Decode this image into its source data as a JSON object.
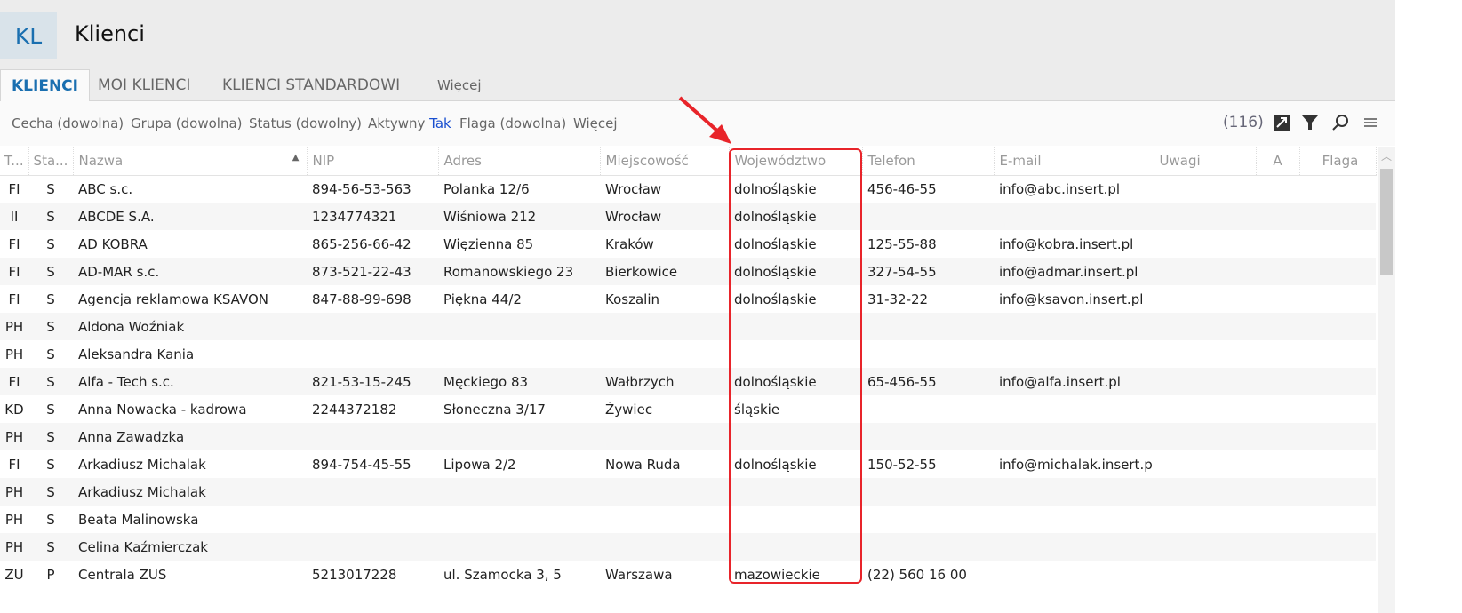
{
  "header": {
    "logo": "KL",
    "title": "Klienci"
  },
  "tabs": [
    "KLIENCI",
    "MOI KLIENCI",
    "KLIENCI STANDARDOWI",
    "Więcej"
  ],
  "filters": {
    "cecha": "Cecha (dowolna)",
    "grupa": "Grupa (dowolna)",
    "status": "Status (dowolny)",
    "aktywny_label": "Aktywny",
    "aktywny_value": "Tak",
    "flaga": "Flaga (dowolna)",
    "wiecej": "Więcej"
  },
  "toolbar": {
    "count": "(116)"
  },
  "columns": [
    "T...",
    "Sta...",
    "Nazwa",
    "NIP",
    "Adres",
    "Miejscowość",
    "Województwo",
    "Telefon",
    "E-mail",
    "Uwagi",
    "A",
    "Flaga"
  ],
  "rows": [
    [
      "FI",
      "S",
      "ABC s.c.",
      "894-56-53-563",
      "Polanka  12/6",
      "Wrocław",
      "dolnośląskie",
      "456-46-55",
      "info@abc.insert.pl"
    ],
    [
      "II",
      "S",
      "ABCDE S.A.",
      "1234774321",
      "Wiśniowa 212",
      "Wrocław",
      "dolnośląskie",
      "",
      ""
    ],
    [
      "FI",
      "S",
      "AD KOBRA",
      "865-256-66-42",
      "Więzienna  85",
      "Kraków",
      "dolnośląskie",
      "125-55-88",
      "info@kobra.insert.pl"
    ],
    [
      "FI",
      "S",
      "AD-MAR s.c.",
      "873-521-22-43",
      "Romanowskiego 23",
      "Bierkowice",
      "dolnośląskie",
      "327-54-55",
      "info@admar.insert.pl"
    ],
    [
      "FI",
      "S",
      "Agencja reklamowa KSAVON",
      "847-88-99-698",
      "Piękna  44/2",
      "Koszalin",
      "dolnośląskie",
      "31-32-22",
      "info@ksavon.insert.pl"
    ],
    [
      "PH",
      "S",
      "Aldona Woźniak",
      "",
      "",
      "",
      "",
      "",
      ""
    ],
    [
      "PH",
      "S",
      "Aleksandra Kania",
      "",
      "",
      "",
      "",
      "",
      ""
    ],
    [
      "FI",
      "S",
      "Alfa - Tech s.c.",
      "821-53-15-245",
      "Męckiego  83",
      "Wałbrzych",
      "dolnośląskie",
      "65-456-55",
      "info@alfa.insert.pl"
    ],
    [
      "KD",
      "S",
      "Anna Nowacka - kadrowa",
      "2244372182",
      "Słoneczna 3/17",
      "Żywiec",
      "śląskie",
      "",
      ""
    ],
    [
      "PH",
      "S",
      "Anna Zawadzka",
      "",
      "",
      "",
      "",
      "",
      ""
    ],
    [
      "FI",
      "S",
      "Arkadiusz Michalak",
      "894-754-45-55",
      "Lipowa  2/2",
      "Nowa Ruda",
      "dolnośląskie",
      "150-52-55",
      "info@michalak.insert.pl"
    ],
    [
      "PH",
      "S",
      "Arkadiusz Michalak",
      "",
      "",
      "",
      "",
      "",
      ""
    ],
    [
      "PH",
      "S",
      "Beata Malinowska",
      "",
      "",
      "",
      "",
      "",
      ""
    ],
    [
      "PH",
      "S",
      "Celina Kaźmierczak",
      "",
      "",
      "",
      "",
      "",
      ""
    ],
    [
      "ZU",
      "P",
      "Centrala ZUS",
      "5213017228",
      "ul. Szamocka 3, 5",
      "Warszawa",
      "mazowieckie",
      "(22) 560 16 00",
      ""
    ]
  ],
  "colors": {
    "accent": "#1a6fb0",
    "highlight": "#e8242a"
  }
}
